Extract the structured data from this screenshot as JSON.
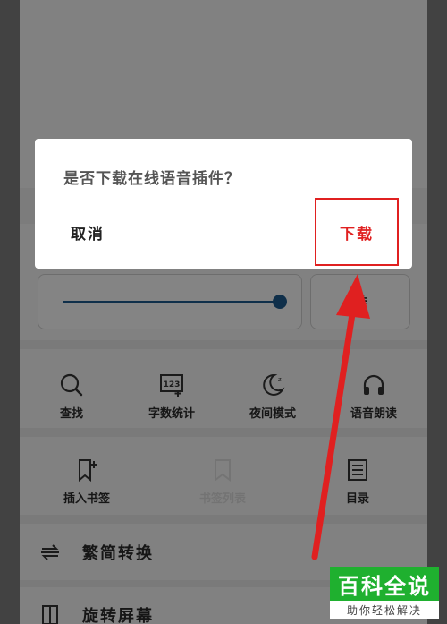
{
  "dialog": {
    "message": "是否下载在线语音插件？",
    "cancel_label": "取消",
    "confirm_label": "下载"
  },
  "reader_settings": {
    "brightness_level": 1.0,
    "side_button_label": "转"
  },
  "tools_row1": [
    {
      "icon": "search-icon",
      "label": "查找"
    },
    {
      "icon": "word-count-icon",
      "glyph": "123",
      "label": "字数统计"
    },
    {
      "icon": "moon-icon",
      "label": "夜间模式"
    },
    {
      "icon": "headphones-icon",
      "label": "语音朗读"
    }
  ],
  "tools_row2": [
    {
      "icon": "bookmark-add-icon",
      "label": "插入书签"
    },
    {
      "icon": "bookmark-list-icon",
      "label": "书签列表"
    },
    {
      "icon": "toc-icon",
      "label": "目录"
    }
  ],
  "menu": [
    {
      "icon": "convert-icon",
      "label": "繁简转换"
    },
    {
      "icon": "rotate-screen-icon",
      "label": "旋转屏幕"
    }
  ],
  "annotation": {
    "highlight_color": "#e02020"
  },
  "watermark": {
    "title": "百科全说",
    "subtitle": "助你轻松解决",
    "color": "#1fb02f"
  }
}
